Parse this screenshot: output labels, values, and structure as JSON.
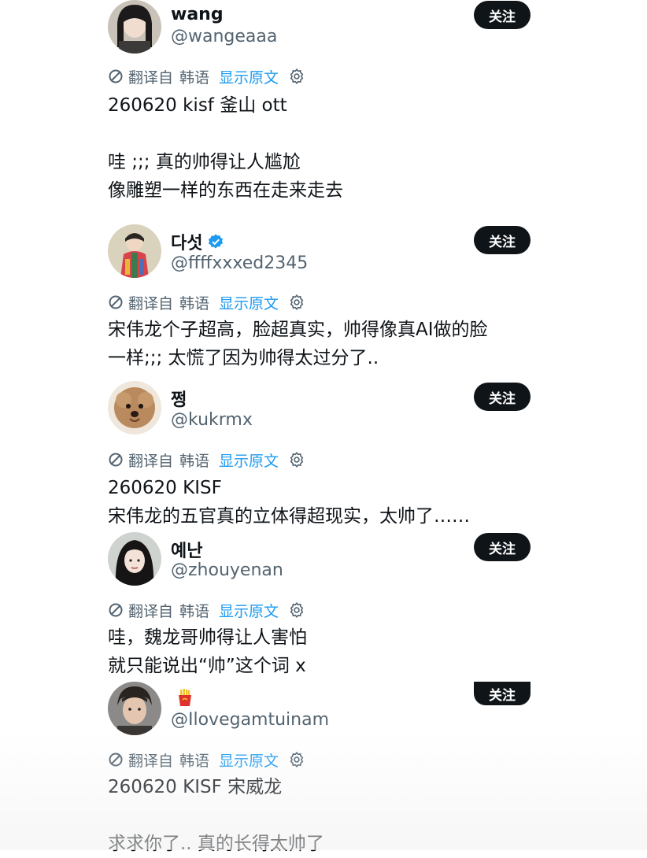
{
  "translate_bar": {
    "translated_from": "翻译自",
    "language": "韩语",
    "show_original": "显示原文"
  },
  "follow_label": "关注",
  "posts": [
    {
      "name": "wang",
      "handle": "@wangeaaa",
      "verified": false,
      "lines": [
        "260620 kisf 釜山 ott",
        "",
        "哇 ;;; 真的帅得让人尴尬",
        "像雕塑一样的东西在走来走去"
      ]
    },
    {
      "name": "다섯",
      "handle": "@ffffxxxed2345",
      "verified": true,
      "lines": [
        "宋伟龙个子超高，脸超真实，帅得像真AI做的脸",
        "一样;;; 太慌了因为帅得太过分了.."
      ]
    },
    {
      "name": "쩡",
      "handle": "@kukrmx",
      "verified": false,
      "lines": [
        "260620 KISF",
        "宋伟龙的五官真的立体得超现实，太帅了……"
      ]
    },
    {
      "name": "예난",
      "handle": "@zhouyenan",
      "verified": false,
      "lines": [
        "哇，魏龙哥帅得让人害怕",
        "就只能说出“帅”这个词 x"
      ]
    },
    {
      "name": "",
      "name_icon": "fries-emoji-icon",
      "handle": "@Ilovegamtuinam",
      "verified": false,
      "lines": [
        "260620 KISF 宋威龙",
        "",
        "求求你了.. 真的长得太帅了"
      ]
    }
  ]
}
